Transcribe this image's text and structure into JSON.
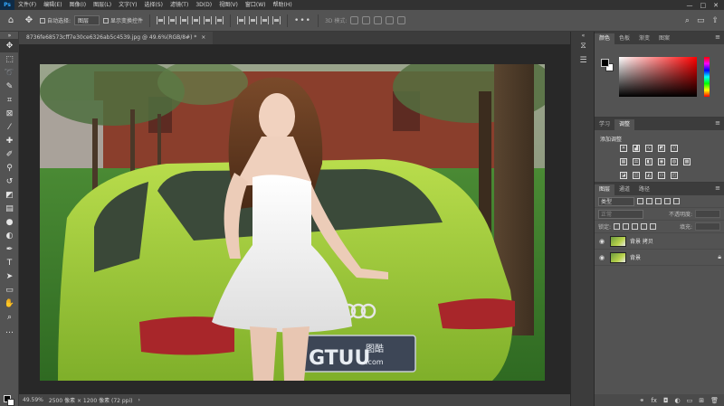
{
  "menubar": {
    "logo": "Ps",
    "items": [
      "文件(F)",
      "编辑(E)",
      "图像(I)",
      "图层(L)",
      "文字(Y)",
      "选择(S)",
      "滤镜(T)",
      "3D(D)",
      "视图(V)",
      "窗口(W)",
      "帮助(H)"
    ],
    "controls": [
      "—",
      "□",
      "✕"
    ]
  },
  "options": {
    "auto_select_label": "自动选择:",
    "auto_select_value": "图层",
    "transform_label": "显示变换控件",
    "mode3d_label": "3D 模式:",
    "more": "•••"
  },
  "document": {
    "tab_title": "8736fe68573cff7e30ce6326ab5c4539.jpg @ 49.6%(RGB/8#) *",
    "tab_close": "×"
  },
  "photo": {
    "watermark_main": "GTUU",
    "watermark_side": "图酷",
    "watermark_sub": ".com",
    "plate_text": "GTUU"
  },
  "status": {
    "zoom": "49.59%",
    "doc_info": "2500 像素 × 1200 像素 (72 ppi)"
  },
  "panels": {
    "color_tabs": [
      "颜色",
      "色板",
      "渐变",
      "图案"
    ],
    "adj_tabs": [
      "学习",
      "调整"
    ],
    "adj_title": "添加调整",
    "layers_tabs": [
      "图层",
      "通道",
      "路径"
    ],
    "kind": "类型",
    "blend": "正常",
    "opacity_label": "不透明度:",
    "lock_label": "锁定:",
    "fill_label": "填充:",
    "layers": [
      {
        "name": "背景 拷贝",
        "selected": false
      },
      {
        "name": "背景",
        "selected": false
      }
    ]
  },
  "colors": {
    "accent_blue": "#31a8ff",
    "grass": "#5a8f3c",
    "car": "#9ccf3a"
  }
}
